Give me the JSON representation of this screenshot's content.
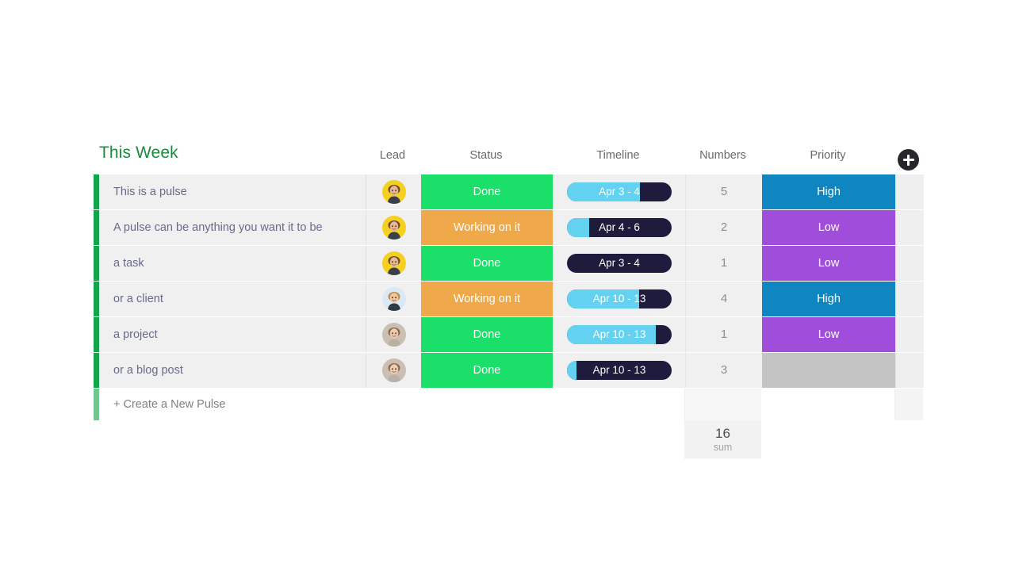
{
  "board": {
    "title": "This Week",
    "title_color": "#1b8a3f",
    "add_column_icon": "plus-icon",
    "columns": [
      {
        "key": "lead",
        "label": "Lead"
      },
      {
        "key": "status",
        "label": "Status"
      },
      {
        "key": "timeline",
        "label": "Timeline"
      },
      {
        "key": "numbers",
        "label": "Numbers"
      },
      {
        "key": "priority",
        "label": "Priority"
      }
    ],
    "accent_color": "#11a64a",
    "status_colors": {
      "Done": "#1ae06a",
      "Working on it": "#efa84a"
    },
    "priority_colors": {
      "High": "#0f86c0",
      "Low": "#a14ddb",
      "": "#c4c4c4"
    },
    "timeline_colors": {
      "track": "#1e1b3c",
      "fill": "#63d2f0"
    },
    "rows": [
      {
        "name": "This is a pulse",
        "lead_avatar": "avatar-yellow",
        "status": "Done",
        "timeline": "Apr 3 - 4",
        "timeline_progress": 70,
        "numbers": "5",
        "priority": "High"
      },
      {
        "name": "A pulse can be anything you want it to be",
        "lead_avatar": "avatar-yellow",
        "status": "Working on it",
        "timeline": "Apr 4 - 6",
        "timeline_progress": 21,
        "numbers": "2",
        "priority": "Low"
      },
      {
        "name": "a task",
        "lead_avatar": "avatar-yellow",
        "status": "Done",
        "timeline": "Apr 3 - 4",
        "timeline_progress": 0,
        "numbers": "1",
        "priority": "Low"
      },
      {
        "name": "or a client",
        "lead_avatar": "avatar-blue",
        "status": "Working on it",
        "timeline": "Apr 10 - 13",
        "timeline_progress": 69,
        "numbers": "4",
        "priority": "High"
      },
      {
        "name": "a project",
        "lead_avatar": "avatar-tan",
        "status": "Done",
        "timeline": "Apr 10 - 13",
        "timeline_progress": 85,
        "numbers": "1",
        "priority": "Low"
      },
      {
        "name": "or a blog post",
        "lead_avatar": "avatar-tan",
        "status": "Done",
        "timeline": "Apr 10 - 13",
        "timeline_progress": 9,
        "numbers": "3",
        "priority": ""
      }
    ],
    "new_pulse": {
      "label": "+ Create a New Pulse",
      "accent_color": "#72c490"
    },
    "summary": {
      "value": "16",
      "label": "sum"
    }
  }
}
